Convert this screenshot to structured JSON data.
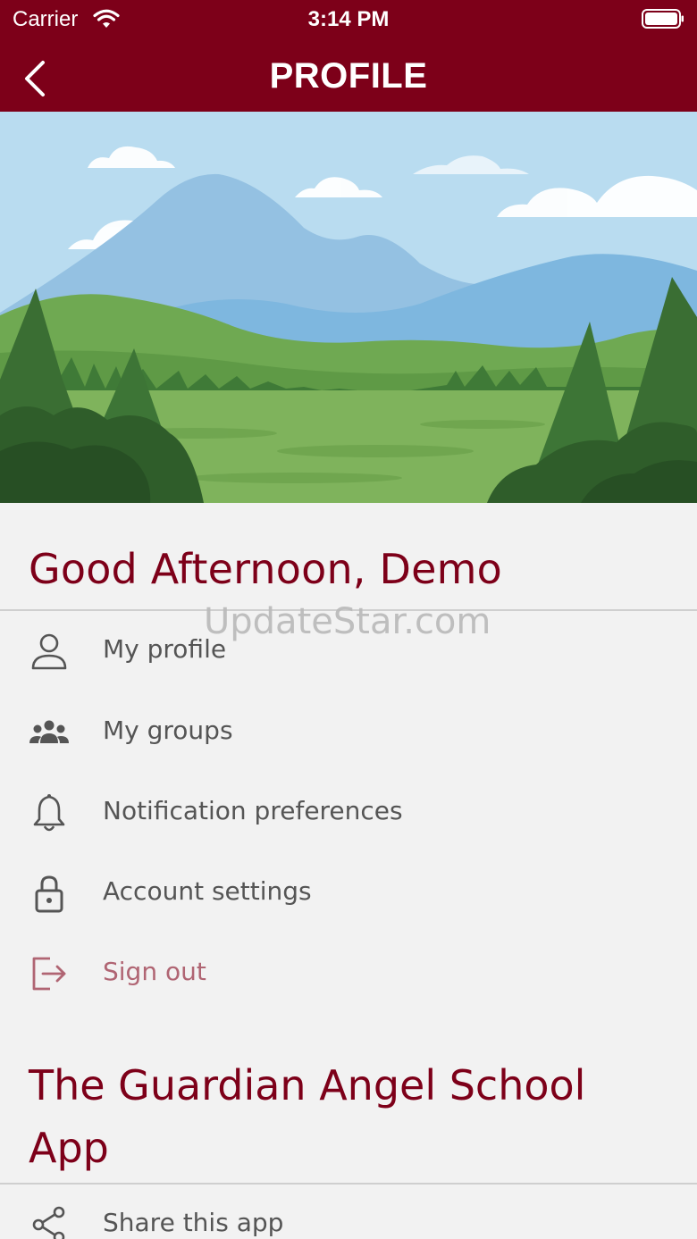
{
  "status_bar": {
    "carrier": "Carrier",
    "time": "3:14 PM"
  },
  "nav": {
    "title": "PROFILE"
  },
  "greeting": "Good Afternoon, Demo",
  "watermark": "UpdateStar.com",
  "menu": [
    {
      "label": "My profile",
      "icon": "person-icon"
    },
    {
      "label": "My groups",
      "icon": "group-icon"
    },
    {
      "label": "Notification preferences",
      "icon": "bell-icon"
    },
    {
      "label": "Account settings",
      "icon": "lock-icon"
    },
    {
      "label": "Sign out",
      "icon": "sign-out-icon"
    }
  ],
  "school": {
    "title": "The Guardian Angel School App"
  },
  "share": {
    "label": "Share this app",
    "icon": "share-icon"
  },
  "colors": {
    "brand": "#7d0019",
    "background": "#f2f2f2",
    "signout": "#b06573",
    "text": "#555555"
  }
}
